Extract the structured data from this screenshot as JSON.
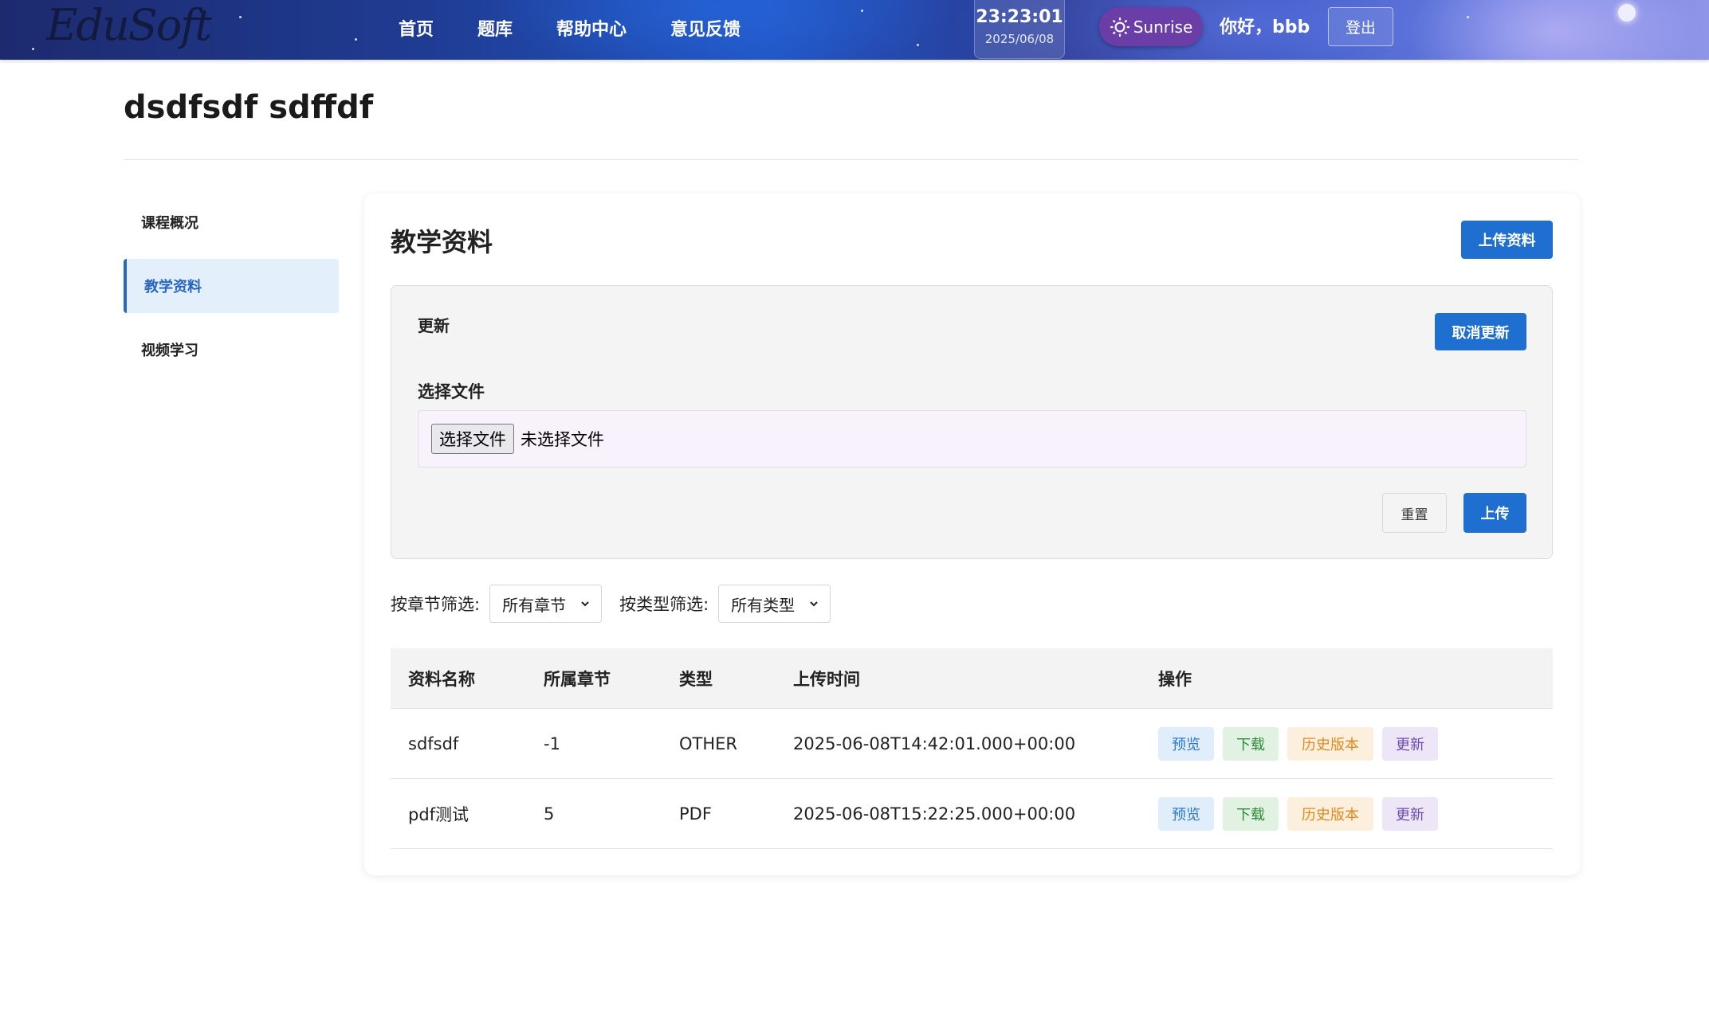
{
  "header": {
    "logo_text": "EduSoft",
    "nav": [
      "首页",
      "题库",
      "帮助中心",
      "意见反馈"
    ],
    "clock_time": "23:23:01",
    "clock_date": "2025/06/08",
    "theme_label": "Sunrise",
    "greeting": "你好，bbb",
    "logout_label": "登出"
  },
  "course": {
    "title": "dsdfsdf sdffdf"
  },
  "sidebar": {
    "items": [
      {
        "label": "课程概况"
      },
      {
        "label": "教学资料"
      },
      {
        "label": "视频学习"
      }
    ]
  },
  "main": {
    "title": "教学资料",
    "upload_button": "上传资料",
    "update_panel": {
      "title": "更新",
      "cancel_button": "取消更新",
      "file_label": "选择文件",
      "file_button": "选择文件",
      "file_status": "未选择文件",
      "reset_button": "重置",
      "upload_button": "上传"
    },
    "filters": {
      "chapter_label": "按章节筛选:",
      "chapter_value": "所有章节",
      "type_label": "按类型筛选:",
      "type_value": "所有类型"
    },
    "table": {
      "headers": [
        "资料名称",
        "所属章节",
        "类型",
        "上传时间",
        "操作"
      ],
      "rows": [
        {
          "name": "sdfsdf",
          "chapter": "-1",
          "type": "OTHER",
          "time": "2025-06-08T14:42:01.000+00:00"
        },
        {
          "name": "pdf测试",
          "chapter": "5",
          "type": "PDF",
          "time": "2025-06-08T15:22:25.000+00:00"
        }
      ],
      "actions": {
        "preview": "预览",
        "download": "下载",
        "history": "历史版本",
        "update": "更新"
      }
    }
  },
  "colors": {
    "primary": "#1f6fd1",
    "active_bg": "#e3effb",
    "theme_button": "#6a3ea6"
  }
}
